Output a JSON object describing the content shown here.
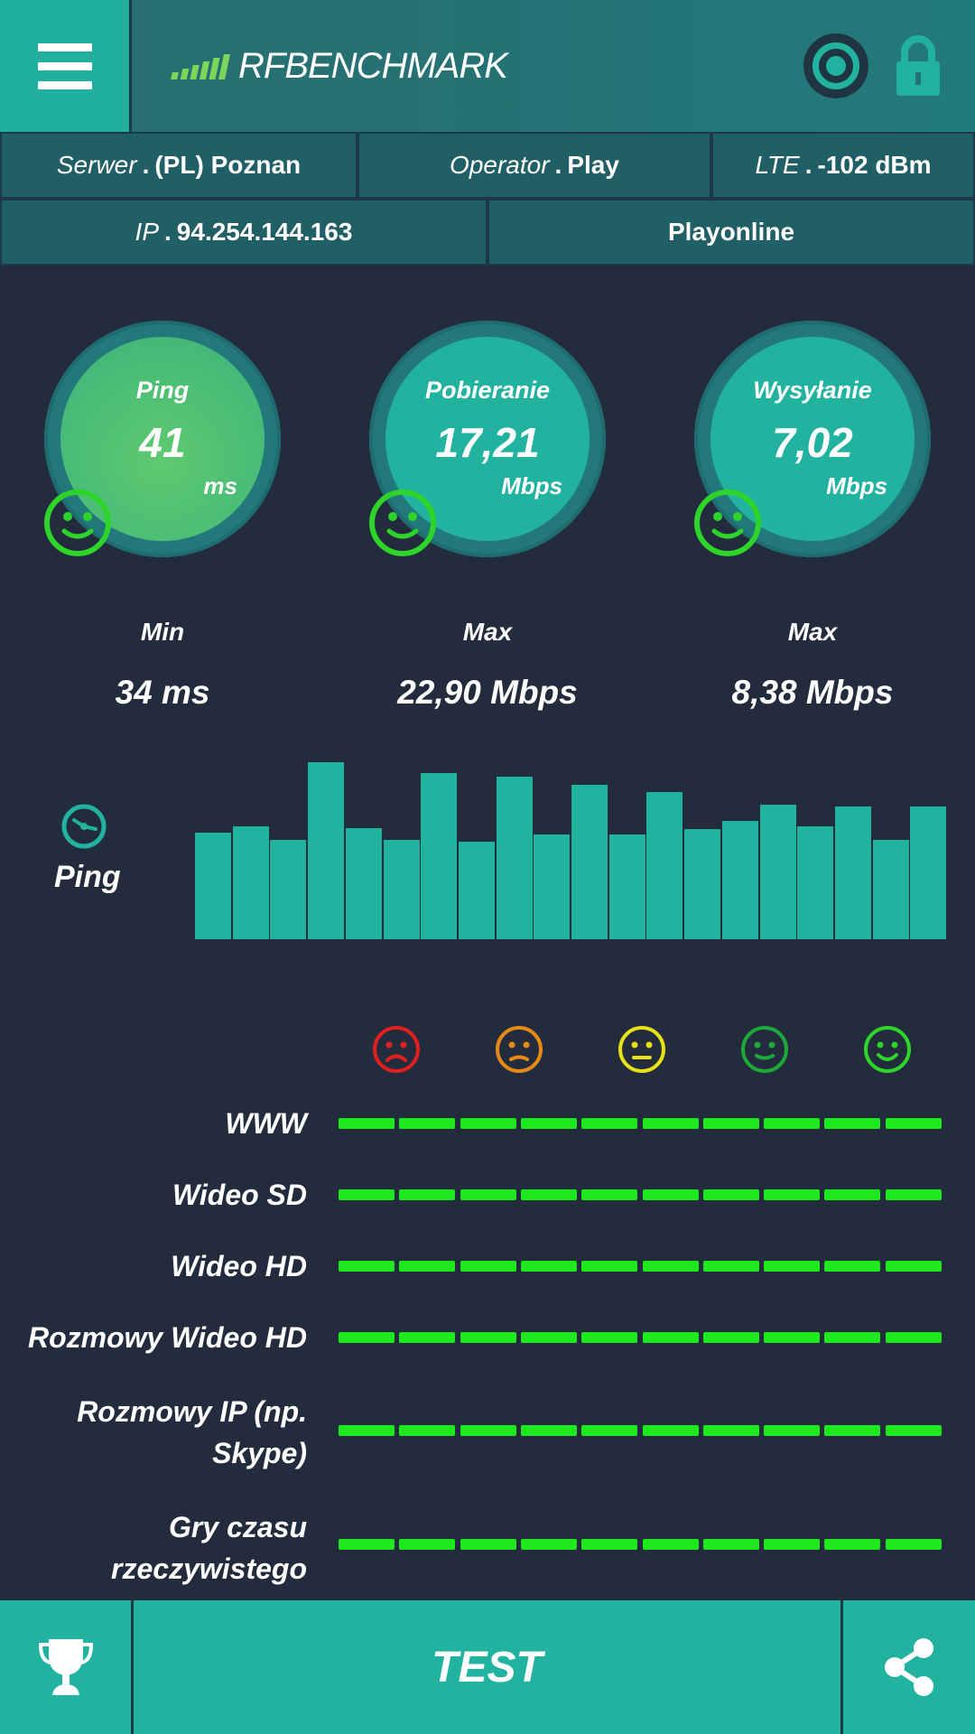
{
  "header": {
    "app_name": "RFBENCHMARK"
  },
  "info": {
    "server_key": "Serwer",
    "server_value": "(PL) Poznan",
    "operator_key": "Operator",
    "operator_value": "Play",
    "network_key": "LTE",
    "network_value": "-102 dBm",
    "ip_key": "IP",
    "ip_value": "94.254.144.163",
    "provider": "Playonline"
  },
  "gauges": [
    {
      "label": "Ping",
      "value": "41",
      "unit": "ms"
    },
    {
      "label": "Pobieranie",
      "value": "17,21",
      "unit": "Mbps"
    },
    {
      "label": "Wysyłanie",
      "value": "7,02",
      "unit": "Mbps"
    }
  ],
  "stats": [
    {
      "label": "Min",
      "value": "34 ms"
    },
    {
      "label": "Max",
      "value": "22,90 Mbps"
    },
    {
      "label": "Max",
      "value": "8,38 Mbps"
    }
  ],
  "ping_chart": {
    "label": "Ping",
    "relative_heights": [
      0.6,
      0.64,
      0.56,
      1.0,
      0.63,
      0.56,
      0.94,
      0.55,
      0.92,
      0.59,
      0.87,
      0.59,
      0.83,
      0.62,
      0.67,
      0.76,
      0.64,
      0.75,
      0.56,
      0.75
    ]
  },
  "quality": {
    "faces": [
      {
        "mood": "very-bad",
        "color": "#e0201f"
      },
      {
        "mood": "bad",
        "color": "#e58a14"
      },
      {
        "mood": "neutral",
        "color": "#e6e015"
      },
      {
        "mood": "good",
        "color": "#1fa83a"
      },
      {
        "mood": "very-good",
        "color": "#2fd42a"
      }
    ],
    "rows": [
      {
        "label": "WWW",
        "level": 10
      },
      {
        "label": "Wideo SD",
        "level": 10
      },
      {
        "label": "Wideo HD",
        "level": 10
      },
      {
        "label": "Rozmowy Wideo HD",
        "level": 10
      },
      {
        "label": "Rozmowy IP (np.\nSkype)",
        "level": 10
      },
      {
        "label": "Gry czasu\nrzeczywistego",
        "level": 10
      }
    ],
    "bar_color": "#1ee81e"
  },
  "bottom": {
    "test_label": "TEST"
  },
  "colors": {
    "background": "#222c3c",
    "accent": "#22b3a0",
    "header": "#257275",
    "smiley_green": "#2fd42a"
  }
}
